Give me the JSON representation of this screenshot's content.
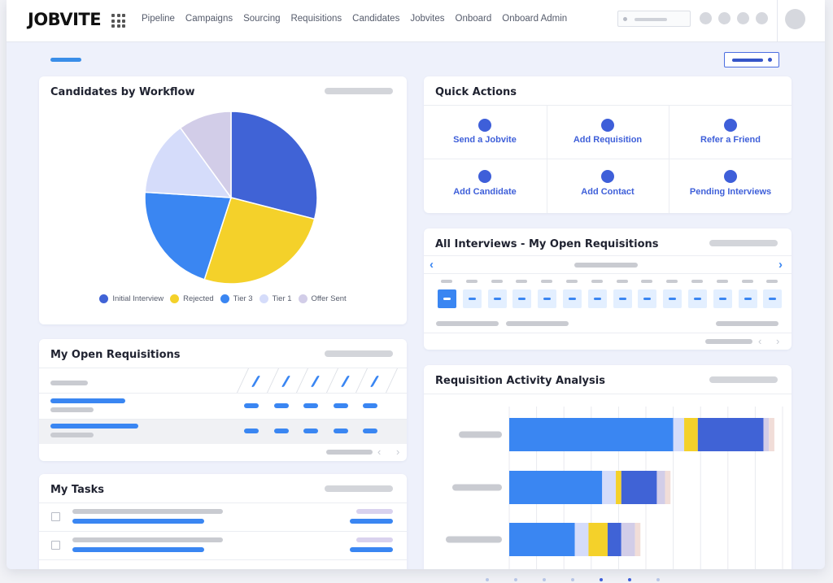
{
  "app": {
    "logo": "JOBVITE"
  },
  "nav": {
    "items": [
      "Pipeline",
      "Campaigns",
      "Sourcing",
      "Requisitions",
      "Candidates",
      "Jobvites",
      "Onboard",
      "Onboard Admin"
    ]
  },
  "cards": {
    "workflow": {
      "title": "Candidates by Workflow"
    },
    "quick_actions": {
      "title": "Quick Actions",
      "items": [
        "Send a Jobvite",
        "Add Requisition",
        "Refer a Friend",
        "Add Candidate",
        "Add Contact",
        "Pending Interviews"
      ]
    },
    "interviews": {
      "title": "All Interviews - My Open Requisitions"
    },
    "requisitions": {
      "title": "My Open Requisitions"
    },
    "activity": {
      "title": "Requisition Activity Analysis"
    },
    "tasks": {
      "title": "My Tasks"
    }
  },
  "colors": {
    "accent_blue": "#3a86f2",
    "action_blue": "#3e5fd9",
    "yellow": "#f4d12a"
  },
  "chart_data": [
    {
      "type": "pie",
      "title": "Candidates by Workflow",
      "slices": [
        {
          "label": "Initial Interview",
          "value": 29,
          "color": "#4063d6"
        },
        {
          "label": "Rejected",
          "value": 26,
          "color": "#f4d12a"
        },
        {
          "label": "Tier 3",
          "value": 21,
          "color": "#3a86f2"
        },
        {
          "label": "Tier 1",
          "value": 14,
          "color": "#d5dcfa"
        },
        {
          "label": "Offer Sent",
          "value": 10,
          "color": "#d2cde8"
        }
      ],
      "legend": "bottom"
    },
    {
      "type": "bar",
      "orientation": "horizontal",
      "stacked": true,
      "title": "Requisition Activity Analysis",
      "categories": [
        "",
        "",
        ""
      ],
      "series": [
        {
          "values": [
            60,
            34,
            24
          ],
          "color": "#3a86f2"
        },
        {
          "values": [
            4,
            5,
            5
          ],
          "color": "#d5dcfa"
        },
        {
          "values": [
            5,
            2,
            7
          ],
          "color": "#f4d12a"
        },
        {
          "values": [
            24,
            13,
            5
          ],
          "color": "#4063d6"
        },
        {
          "values": [
            2,
            3,
            5
          ],
          "color": "#d2cde8"
        },
        {
          "values": [
            2,
            2,
            2
          ],
          "color": "#f1ddd8"
        }
      ],
      "xlim": [
        0,
        100
      ],
      "grid": true
    }
  ]
}
